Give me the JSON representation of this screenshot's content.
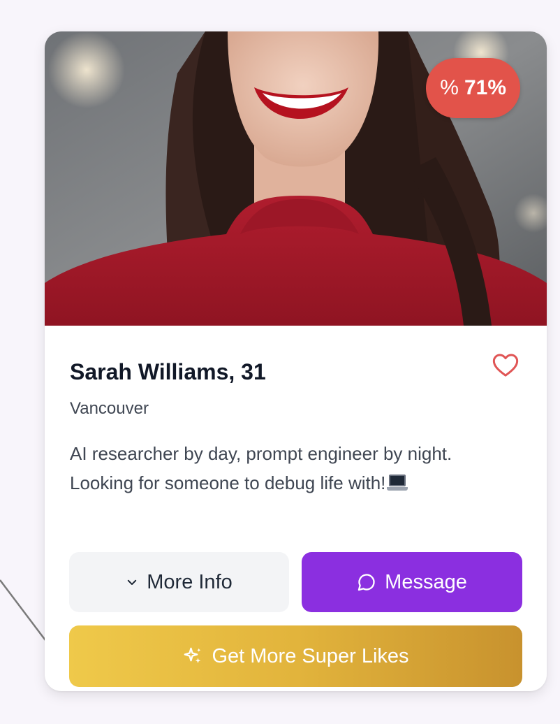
{
  "card": {
    "match_percent": "71%",
    "match_icon": "%",
    "name": "Sarah Williams, 31",
    "location": "Vancouver",
    "bio": "AI researcher by day, prompt engineer by night. Looking for someone to debug life with!",
    "bio_emoji": "laptop-emoji"
  },
  "actions": {
    "more_info_label": "More Info",
    "message_label": "Message",
    "super_likes_label": "Get More Super Likes"
  },
  "colors": {
    "badge": "#e2534a",
    "message_button": "#8b2fe0",
    "super_likes_gradient_start": "#efc94a",
    "super_likes_gradient_end": "#c8922e",
    "heart_outline": "#e05555"
  },
  "icons": {
    "heart": "heart-outline-icon",
    "chevron": "chevron-down-icon",
    "message": "chat-bubble-icon",
    "super": "sparkles-icon",
    "percent": "percent-icon"
  }
}
